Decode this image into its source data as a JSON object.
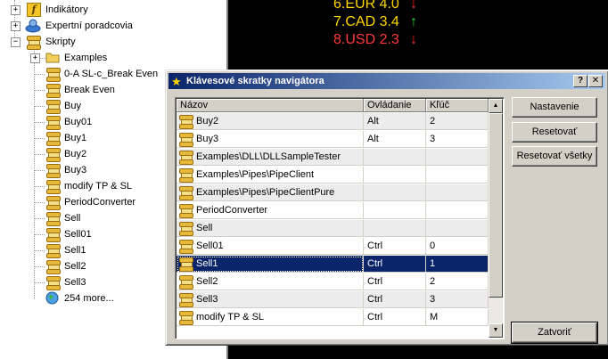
{
  "navigator": {
    "indicators_label": "Indikátory",
    "experts_label": "Expertní poradcovia",
    "scripts_label": "Skripty",
    "examples_label": "Examples",
    "scripts": [
      "0-A SL-c_Break Even",
      "Break Even",
      "Buy",
      "Buy01",
      "Buy1",
      "Buy2",
      "Buy3",
      "modify TP & SL",
      "PeriodConverter",
      "Sell",
      "Sell01",
      "Sell1",
      "Sell2",
      "Sell3"
    ],
    "more_label": "254 more..."
  },
  "chart": {
    "quotes": [
      {
        "text": "6.EUR 4.0",
        "color": "#ffd700",
        "arrow": "↓",
        "arrow_color": "#ff2a2a"
      },
      {
        "text": "7.CAD 3.4",
        "color": "#ffd700",
        "arrow": "↑",
        "arrow_color": "#22dd22"
      },
      {
        "text": "8.USD 2.3",
        "color": "#ff3a3a",
        "arrow": "↓",
        "arrow_color": "#ff2a2a"
      }
    ]
  },
  "dialog": {
    "title": "Klávesové skratky navigátora",
    "help_button": "?",
    "close_button": "✕",
    "columns": [
      "Názov",
      "Ovládanie",
      "Kľúč"
    ],
    "rows": [
      {
        "name": "Buy2",
        "control": "Alt",
        "key": "2",
        "selected": false
      },
      {
        "name": "Buy3",
        "control": "Alt",
        "key": "3",
        "selected": false
      },
      {
        "name": "Examples\\DLL\\DLLSampleTester",
        "control": "",
        "key": "",
        "selected": false
      },
      {
        "name": "Examples\\Pipes\\PipeClient",
        "control": "",
        "key": "",
        "selected": false
      },
      {
        "name": "Examples\\Pipes\\PipeClientPure",
        "control": "",
        "key": "",
        "selected": false
      },
      {
        "name": "PeriodConverter",
        "control": "",
        "key": "",
        "selected": false
      },
      {
        "name": "Sell",
        "control": "",
        "key": "",
        "selected": false
      },
      {
        "name": "Sell01",
        "control": "Ctrl",
        "key": "0",
        "selected": false
      },
      {
        "name": "Sell1",
        "control": "Ctrl",
        "key": "1",
        "selected": true
      },
      {
        "name": "Sell2",
        "control": "Ctrl",
        "key": "2",
        "selected": false
      },
      {
        "name": "Sell3",
        "control": "Ctrl",
        "key": "3",
        "selected": false
      },
      {
        "name": "modify TP & SL",
        "control": "Ctrl",
        "key": "M",
        "selected": false
      }
    ],
    "buttons": {
      "setup": "Nastavenie",
      "reset": "Resetovať",
      "reset_all": "Resetovať všetky",
      "close": "Zatvoriť"
    },
    "scroll": {
      "up": "▲",
      "down": "▼"
    }
  }
}
